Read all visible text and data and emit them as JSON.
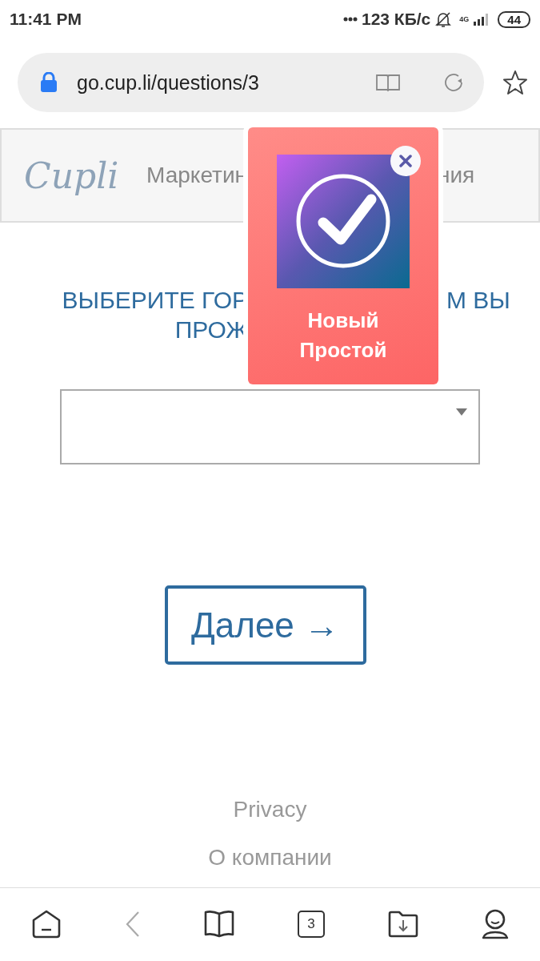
{
  "status_bar": {
    "time": "11:41 PM",
    "network_speed": "123 КБ/с",
    "network_type": "4G",
    "battery": "44"
  },
  "address_bar": {
    "url": "go.cup.li/questions/3"
  },
  "site_header": {
    "logo": "Cupli",
    "tagline_parts": [
      "Маркетин",
      "ния"
    ]
  },
  "question": {
    "lines": [
      {
        "left": "ВЫБЕРИТЕ ГОР",
        "right": "М ВЫ"
      },
      {
        "left": "ПРОЖ"
      }
    ]
  },
  "city_select": {
    "open": false
  },
  "next_button": {
    "label": "Далее →"
  },
  "footer_links": [
    "Privacy",
    "О компании"
  ],
  "popup": {
    "title": "Новый Простой"
  },
  "bottom_nav": [
    {
      "kind": "home",
      "disabled": false
    },
    {
      "kind": "back",
      "disabled": true
    },
    {
      "kind": "bookmarks",
      "disabled": false
    },
    {
      "kind": "tabs",
      "disabled": false,
      "count": "3"
    },
    {
      "kind": "downloads",
      "disabled": false
    },
    {
      "kind": "profile",
      "disabled": false
    }
  ]
}
